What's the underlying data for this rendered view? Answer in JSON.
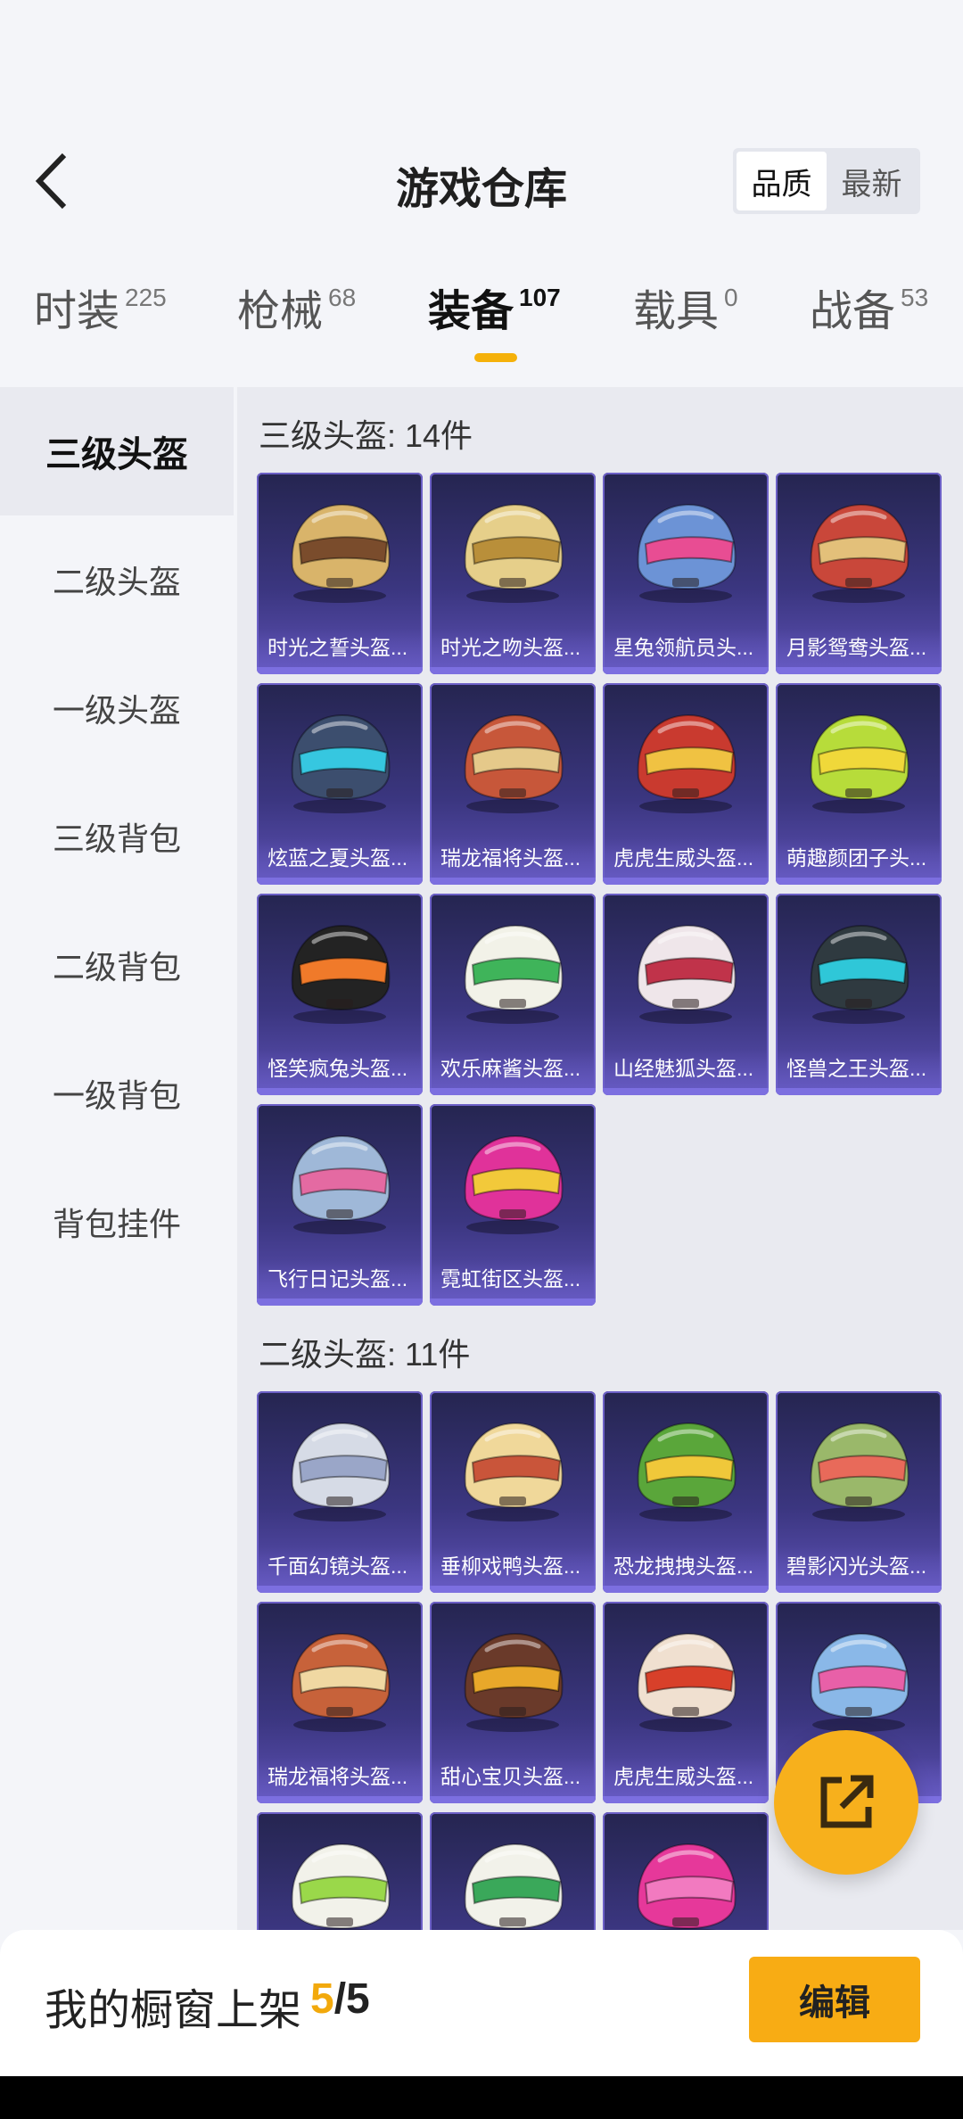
{
  "header": {
    "title": "游戏仓库",
    "sort": [
      "品质",
      "最新"
    ],
    "sort_active": "品质"
  },
  "tabs": [
    {
      "label": "时装",
      "count": "225"
    },
    {
      "label": "枪械",
      "count": "68"
    },
    {
      "label": "装备",
      "count": "107"
    },
    {
      "label": "载具",
      "count": "0"
    },
    {
      "label": "战备",
      "count": "53"
    }
  ],
  "active_tab": "装备",
  "sidebar": [
    "三级头盔",
    "二级头盔",
    "一级头盔",
    "三级背包",
    "二级背包",
    "一级背包",
    "背包挂件"
  ],
  "active_sidebar": "三级头盔",
  "sections": [
    {
      "title": "三级头盔: 14件",
      "items": [
        {
          "name": "时光之誓头盔...",
          "color": "#d9b46a",
          "accent": "#7a4c2c"
        },
        {
          "name": "时光之吻头盔...",
          "color": "#e6cf8a",
          "accent": "#b98f3a"
        },
        {
          "name": "星兔领航员头...",
          "color": "#6c93d6",
          "accent": "#e84d93"
        },
        {
          "name": "月影鸳鸯头盔...",
          "color": "#c9473a",
          "accent": "#e3c07a"
        },
        {
          "name": "炫蓝之夏头盔...",
          "color": "#3c4e6e",
          "accent": "#36c7e0"
        },
        {
          "name": "瑞龙福将头盔...",
          "color": "#c7573a",
          "accent": "#e5c98a"
        },
        {
          "name": "虎虎生威头盔...",
          "color": "#c93a2f",
          "accent": "#f0c242"
        },
        {
          "name": "萌趣颜团子头...",
          "color": "#b7dc3a",
          "accent": "#f0d83a"
        },
        {
          "name": "怪笑疯兔头盔...",
          "color": "#232323",
          "accent": "#f07a2a"
        },
        {
          "name": "欢乐麻酱头盔...",
          "color": "#f2f2e8",
          "accent": "#3fb45a"
        },
        {
          "name": "山经魅狐头盔...",
          "color": "#efe6ea",
          "accent": "#c0334a"
        },
        {
          "name": "怪兽之王头盔...",
          "color": "#2f3a40",
          "accent": "#2fc7d8"
        },
        {
          "name": "飞行日记头盔...",
          "color": "#9fb8d8",
          "accent": "#e46aa2"
        },
        {
          "name": "霓虹街区头盔...",
          "color": "#e0329a",
          "accent": "#f2c93a"
        }
      ]
    },
    {
      "title": "二级头盔: 11件",
      "items": [
        {
          "name": "千面幻镜头盔...",
          "color": "#d6dbe6",
          "accent": "#9aa6c8"
        },
        {
          "name": "垂柳戏鸭头盔...",
          "color": "#f0d89a",
          "accent": "#c9553a"
        },
        {
          "name": "恐龙拽拽头盔...",
          "color": "#5aa63a",
          "accent": "#f0c83a"
        },
        {
          "name": "碧影闪光头盔...",
          "color": "#9ab86a",
          "accent": "#e86a5a"
        },
        {
          "name": "瑞龙福将头盔...",
          "color": "#c7623a",
          "accent": "#f0d8a2"
        },
        {
          "name": "甜心宝贝头盔...",
          "color": "#6a3a2a",
          "accent": "#e8a82a"
        },
        {
          "name": "虎虎生威头盔...",
          "color": "#f0e0d0",
          "accent": "#d8402a"
        },
        {
          "name": "",
          "color": "#8ab8e8",
          "accent": "#e860a8"
        },
        {
          "name": "",
          "color": "#f2f2ea",
          "accent": "#9ad84a"
        },
        {
          "name": "",
          "color": "#f2f2ea",
          "accent": "#3aa85a"
        },
        {
          "name": "",
          "color": "#e6389a",
          "accent": "#f27ac0"
        }
      ]
    }
  ],
  "bottom": {
    "label": "我的橱窗上架",
    "count_current": "5",
    "count_sep": "/",
    "count_total": "5",
    "edit": "编辑"
  }
}
